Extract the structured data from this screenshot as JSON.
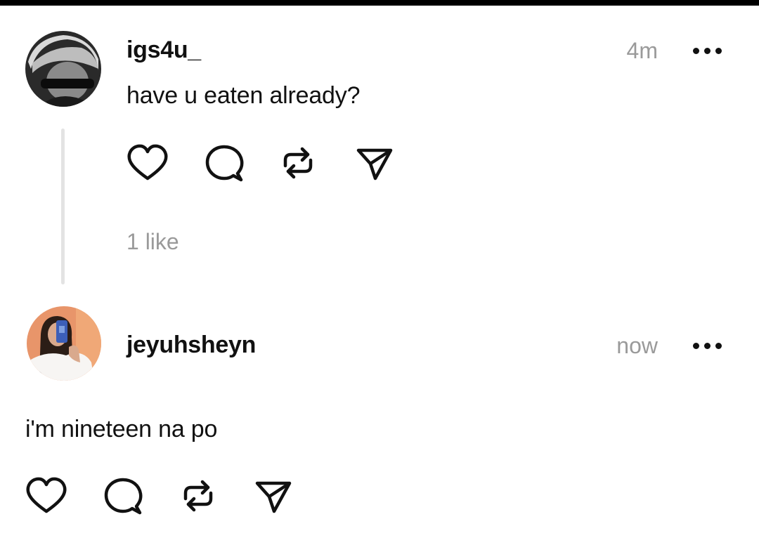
{
  "posts": [
    {
      "username": "igs4u_",
      "time": "4m",
      "text": "have u eaten already?",
      "likes": "1 like",
      "avatar_icon": "avatar-icon"
    },
    {
      "username": "jeyuhsheyn",
      "time": "now",
      "text": "i'm nineteen na po",
      "avatar_icon": "avatar-icon"
    }
  ],
  "icons": {
    "like": "heart-icon",
    "comment": "comment-icon",
    "repost": "repost-icon",
    "share": "send-icon",
    "more": "more-icon"
  },
  "colors": {
    "text": "#111111",
    "muted": "#9a9a9a",
    "thread_line": "#e3e3e3",
    "top_bar": "#000000"
  }
}
